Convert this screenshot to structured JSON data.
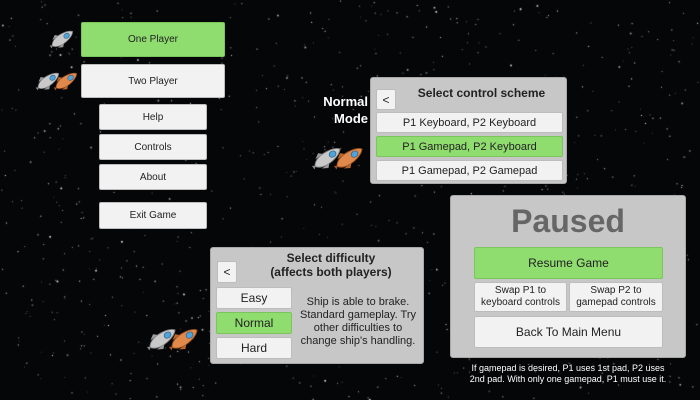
{
  "main_menu": {
    "one_player": "One Player",
    "two_player": "Two Player",
    "help": "Help",
    "controls": "Controls",
    "about": "About",
    "exit_game": "Exit Game"
  },
  "mode_label": {
    "line1": "Normal",
    "line2": "Mode"
  },
  "control_scheme": {
    "title": "Select control scheme",
    "back": "<",
    "options": [
      "P1 Keyboard, P2 Keyboard",
      "P1 Gamepad, P2 Keyboard",
      "P1 Gamepad, P2 Gamepad"
    ],
    "selected_index": 1
  },
  "difficulty": {
    "title_line1": "Select difficulty",
    "title_line2": "(affects both players)",
    "back": "<",
    "options": [
      "Easy",
      "Normal",
      "Hard"
    ],
    "selected_index": 1,
    "description_lines": [
      "Ship is able to brake.",
      "Standard gameplay. Try",
      "other difficulties to",
      "change ship's handling."
    ]
  },
  "pause": {
    "title": "Paused",
    "resume": "Resume Game",
    "swap_p1_line1": "Swap P1 to",
    "swap_p1_line2": "keyboard controls",
    "swap_p2_line1": "Swap P2 to",
    "swap_p2_line2": "gamepad controls",
    "back_to_main": "Back To Main Menu",
    "note_line1": "If gamepad is desired, P1 uses 1st pad, P2 uses",
    "note_line2": "2nd pad. With only one gamepad, P1 must use it."
  },
  "colors": {
    "button_selected": "#8fdc6f",
    "button": "#f2f2f2",
    "panel": "#c7c7c7",
    "background": "#050608",
    "ship_grey": "#c9c9c9",
    "ship_orange": "#e0894a",
    "ship_window": "#4fa3d9"
  },
  "icons": [
    "grey-ship-icon",
    "orange-ship-icon"
  ]
}
